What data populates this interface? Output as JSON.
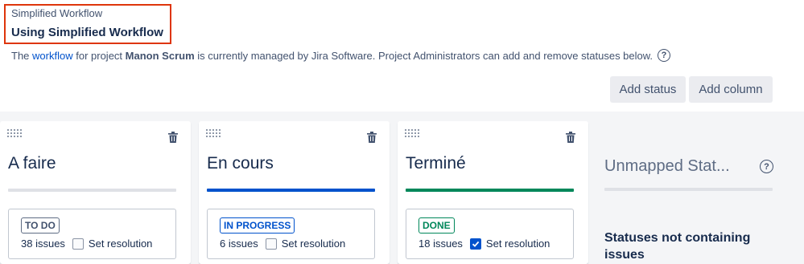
{
  "header": {
    "subtitle": "Simplified Workflow",
    "title": "Using Simplified Workflow"
  },
  "description": {
    "prefix": "The",
    "link": "workflow",
    "middle": "for project",
    "project": "Manon Scrum",
    "suffix": "is currently managed by Jira Software. Project Administrators can add and remove statuses below."
  },
  "toolbar": {
    "add_status": "Add status",
    "add_column": "Add column"
  },
  "columns": [
    {
      "title": "A faire",
      "status": "TO DO",
      "issues": "38 issues",
      "resolution": "Set resolution",
      "resolution_checked": false,
      "color": "#dfe1e6"
    },
    {
      "title": "En cours",
      "status": "IN PROGRESS",
      "issues": "6 issues",
      "resolution": "Set resolution",
      "resolution_checked": false,
      "color": "#0052cc"
    },
    {
      "title": "Terminé",
      "status": "DONE",
      "issues": "18 issues",
      "resolution": "Set resolution",
      "resolution_checked": true,
      "color": "#00875a"
    }
  ],
  "unmapped": {
    "title": "Unmapped Stat...",
    "note": "Statuses not containing issues"
  },
  "icons": {
    "help": "?"
  },
  "colors": {
    "highlight": "#de350b",
    "link": "#0052cc"
  }
}
